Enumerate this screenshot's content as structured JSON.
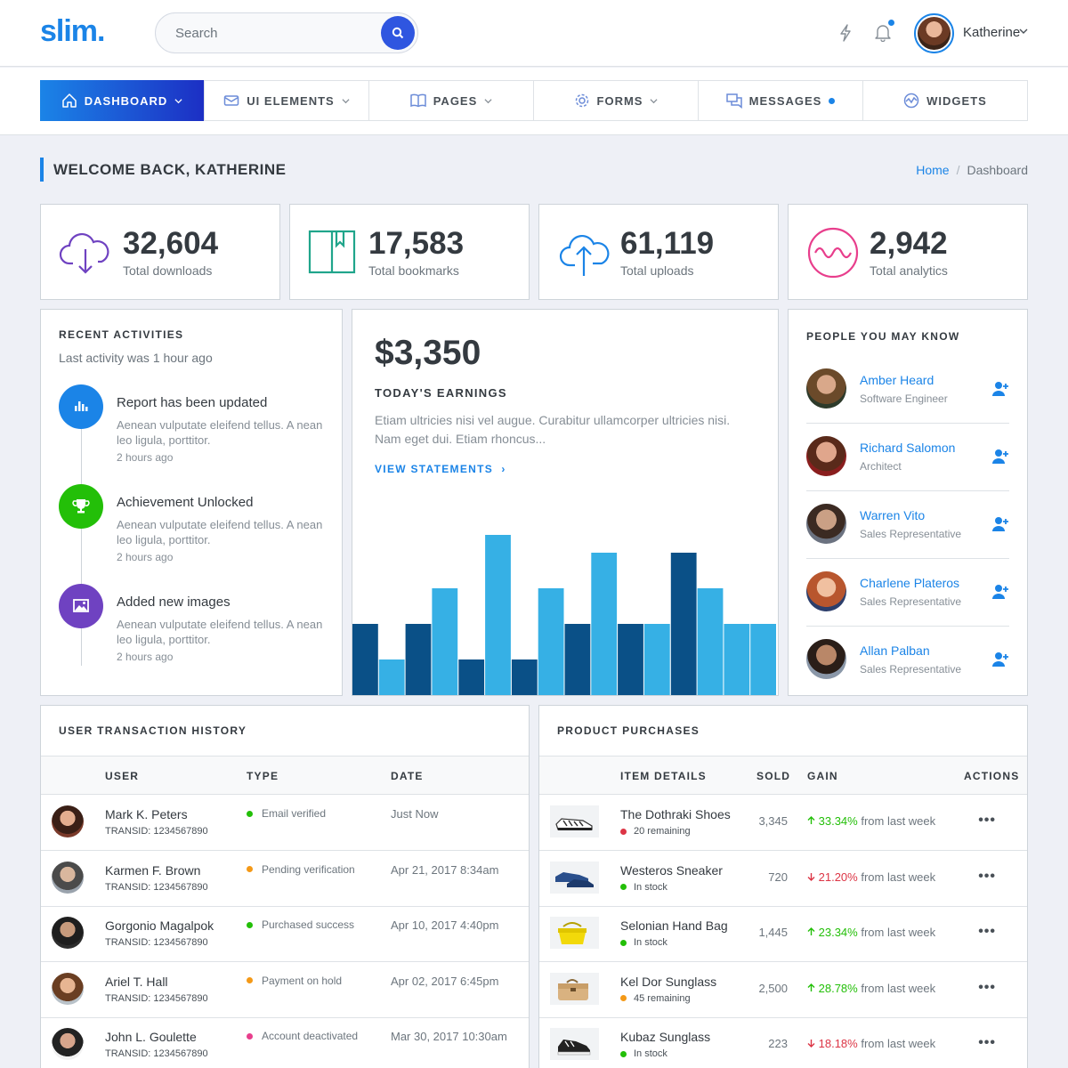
{
  "header": {
    "logo": "slim.",
    "search_placeholder": "Search",
    "user_name": "Katherine",
    "icons": [
      "bolt-icon",
      "bell-icon"
    ]
  },
  "nav": [
    {
      "label": "DASHBOARD",
      "icon": "home-icon",
      "caret": true,
      "dot": false,
      "active": true
    },
    {
      "label": "UI ELEMENTS",
      "icon": "mail-icon",
      "caret": true,
      "dot": false,
      "active": false
    },
    {
      "label": "PAGES",
      "icon": "book-icon",
      "caret": true,
      "dot": false,
      "active": false
    },
    {
      "label": "FORMS",
      "icon": "gear-icon",
      "caret": true,
      "dot": false,
      "active": false
    },
    {
      "label": "MESSAGES",
      "icon": "chat-icon",
      "caret": false,
      "dot": true,
      "active": false
    },
    {
      "label": "WIDGETS",
      "icon": "pulse-icon",
      "caret": false,
      "dot": false,
      "active": false
    }
  ],
  "page": {
    "title": "WELCOME BACK, KATHERINE",
    "breadcrumb_home": "Home",
    "breadcrumb_sep": "/",
    "breadcrumb_current": "Dashboard"
  },
  "stats": [
    {
      "value": "32,604",
      "label": "Total downloads",
      "icon": "cloud-download-icon",
      "color": "#6f42c1"
    },
    {
      "value": "17,583",
      "label": "Total bookmarks",
      "icon": "book-icon",
      "color": "#20a58b"
    },
    {
      "value": "61,119",
      "label": "Total uploads",
      "icon": "cloud-upload-icon",
      "color": "#1b84e7"
    },
    {
      "value": "2,942",
      "label": "Total analytics",
      "icon": "wave-icon",
      "color": "#e83e8c"
    }
  ],
  "activities": {
    "title": "RECENT ACTIVITIES",
    "subtitle": "Last activity was 1 hour ago",
    "items": [
      {
        "title": "Report has been updated",
        "desc": "Aenean vulputate eleifend tellus. A nean leo ligula, porttitor.",
        "time": "2 hours ago",
        "icon": "chart-icon",
        "color": "#1b84e7"
      },
      {
        "title": "Achievement Unlocked",
        "desc": "Aenean vulputate eleifend tellus. A nean leo ligula, porttitor.",
        "time": "2 hours ago",
        "icon": "trophy-icon",
        "color": "#23bf08"
      },
      {
        "title": "Added new images",
        "desc": "Aenean vulputate eleifend tellus. A nean leo ligula, porttitor.",
        "time": "2 hours ago",
        "icon": "image-icon",
        "color": "#6f42c1"
      }
    ]
  },
  "earnings": {
    "amount": "$3,350",
    "label": "TODAY'S EARNINGS",
    "desc": "Etiam ultricies nisi vel augue. Curabitur ullamcorper ultricies nisi. Nam eget dui. Etiam rhoncus...",
    "link": "VIEW STATEMENTS"
  },
  "chart_data": {
    "type": "bar",
    "colors": [
      "#0a5087",
      "#36b0e5"
    ],
    "series": [
      {
        "values": [
          4,
          4,
          2,
          2,
          4,
          4,
          8
        ]
      },
      {
        "values": [
          2,
          6,
          9,
          6,
          8,
          4,
          6,
          4,
          4
        ]
      }
    ],
    "ylim": [
      0,
      10
    ]
  },
  "people": {
    "title": "PEOPLE YOU MAY KNOW",
    "items": [
      {
        "name": "Amber Heard",
        "role": "Software Engineer"
      },
      {
        "name": "Richard Salomon",
        "role": "Architect"
      },
      {
        "name": "Warren Vito",
        "role": "Sales Representative"
      },
      {
        "name": "Charlene Plateros",
        "role": "Sales Representative"
      },
      {
        "name": "Allan Palban",
        "role": "Sales Representative"
      }
    ]
  },
  "transactions": {
    "title": "USER TRANSACTION HISTORY",
    "columns": [
      "USER",
      "TYPE",
      "DATE"
    ],
    "rows": [
      {
        "name": "Mark K. Peters",
        "sub": "TRANSID: 1234567890",
        "type": "Email verified",
        "status_color": "#23bf08",
        "date": "Just Now"
      },
      {
        "name": "Karmen F. Brown",
        "sub": "TRANSID: 1234567890",
        "type": "Pending verification",
        "status_color": "#f49917",
        "date": "Apr 21, 2017 8:34am"
      },
      {
        "name": "Gorgonio Magalpok",
        "sub": "TRANSID: 1234567890",
        "type": "Purchased success",
        "status_color": "#23bf08",
        "date": "Apr 10, 2017 4:40pm"
      },
      {
        "name": "Ariel T. Hall",
        "sub": "TRANSID: 1234567890",
        "type": "Payment on hold",
        "status_color": "#f49917",
        "date": "Apr 02, 2017 6:45pm"
      },
      {
        "name": "John L. Goulette",
        "sub": "TRANSID: 1234567890",
        "type": "Account deactivated",
        "status_color": "#e83e8c",
        "date": "Mar 30, 2017 10:30am"
      }
    ]
  },
  "products": {
    "title": "PRODUCT PURCHASES",
    "columns": [
      "ITEM DETAILS",
      "SOLD",
      "GAIN",
      "ACTIONS"
    ],
    "rows": [
      {
        "name": "The Dothraki Shoes",
        "stock": "20 remaining",
        "stock_color": "#dc3545",
        "sold": "3,345",
        "gain": "33.34%",
        "dir": "up",
        "gain_suffix": "from last week",
        "actions": "•••"
      },
      {
        "name": "Westeros Sneaker",
        "stock": "In stock",
        "stock_color": "#23bf08",
        "sold": "720",
        "gain": "21.20%",
        "dir": "down",
        "gain_suffix": "from last week",
        "actions": "•••"
      },
      {
        "name": "Selonian Hand Bag",
        "stock": "In stock",
        "stock_color": "#23bf08",
        "sold": "1,445",
        "gain": "23.34%",
        "dir": "up",
        "gain_suffix": "from last week",
        "actions": "•••"
      },
      {
        "name": "Kel Dor Sunglass",
        "stock": "45 remaining",
        "stock_color": "#f49917",
        "sold": "2,500",
        "gain": "28.78%",
        "dir": "up",
        "gain_suffix": "from last week",
        "actions": "•••"
      },
      {
        "name": "Kubaz Sunglass",
        "stock": "In stock",
        "stock_color": "#23bf08",
        "sold": "223",
        "gain": "18.18%",
        "dir": "down",
        "gain_suffix": "from last week",
        "actions": "•••"
      }
    ]
  }
}
